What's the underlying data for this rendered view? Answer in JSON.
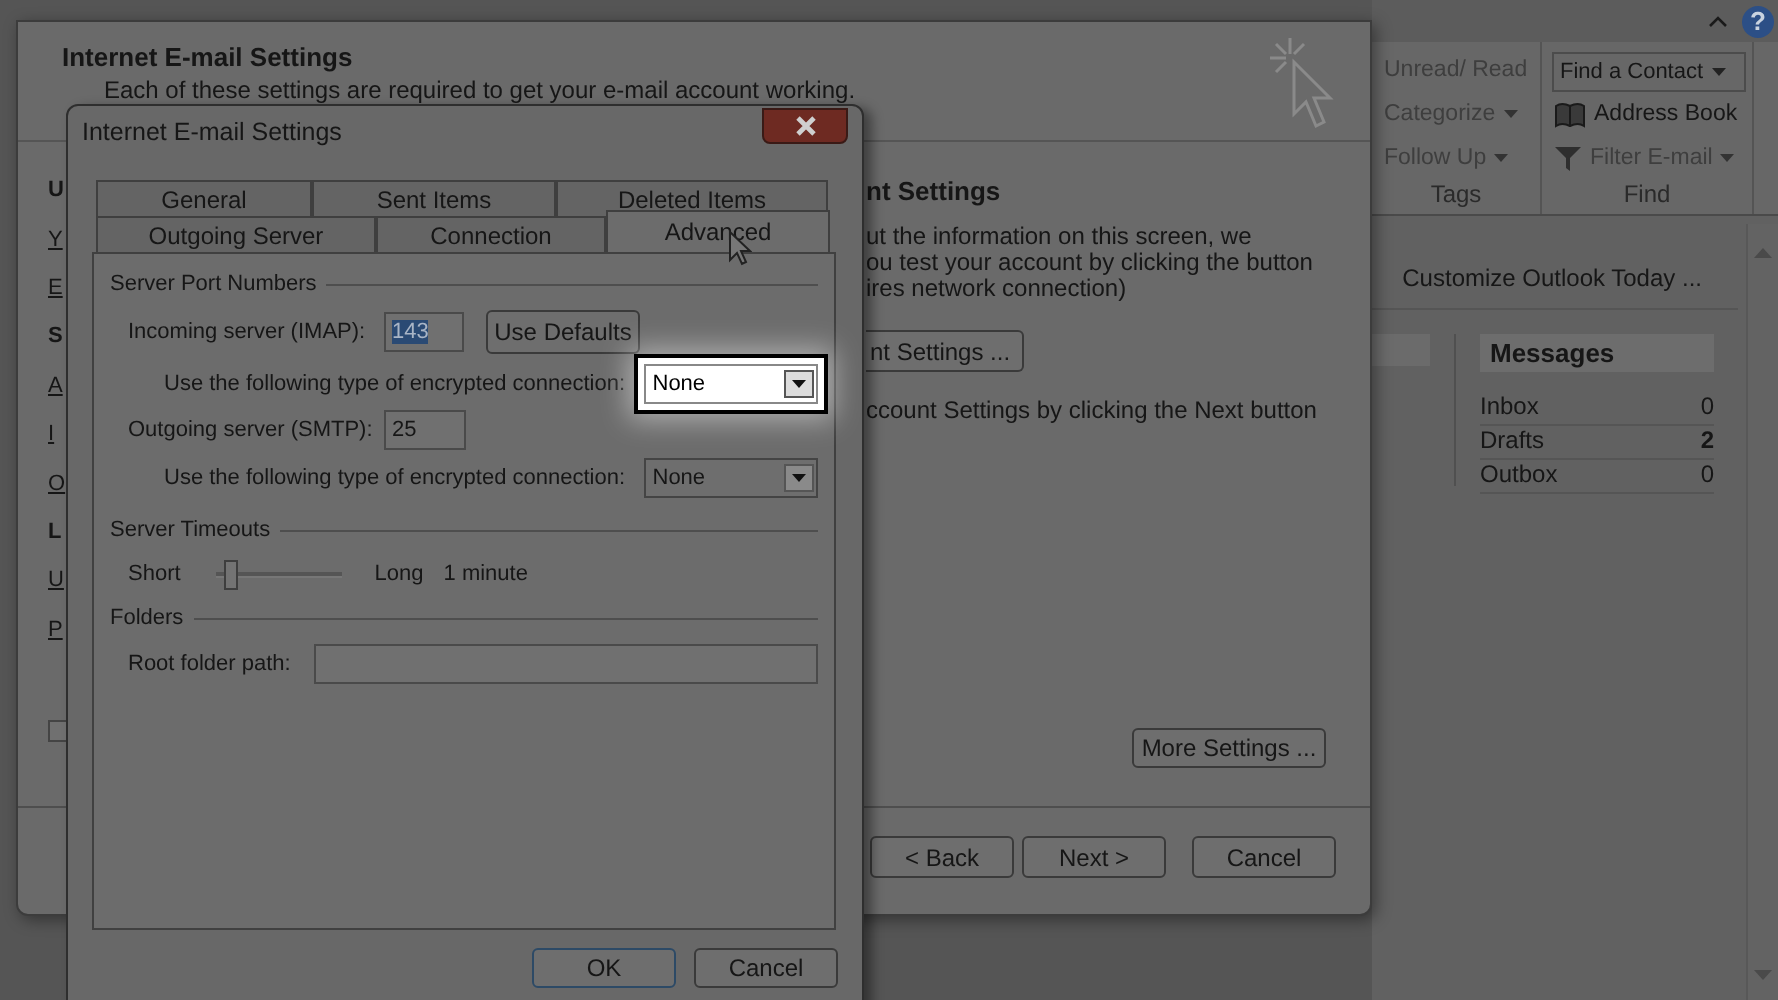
{
  "outlook": {
    "help": "?",
    "tags_group": {
      "label": "Tags",
      "items": [
        {
          "label": "Unread/ Read",
          "dropdown": false
        },
        {
          "label": "Categorize",
          "dropdown": true
        },
        {
          "label": "Follow Up",
          "dropdown": true
        }
      ]
    },
    "find_group": {
      "label": "Find",
      "contact_field": "Find a Contact",
      "items": [
        {
          "label": "Address Book",
          "kind": "book",
          "dropdown": false
        },
        {
          "label": "Filter E-mail",
          "kind": "filter",
          "dropdown": true
        }
      ]
    },
    "customize_link": "Customize Outlook Today ...",
    "messages": {
      "title": "Messages",
      "rows": [
        {
          "name": "Inbox",
          "count": "0",
          "bold": false
        },
        {
          "name": "Drafts",
          "count": "2",
          "bold": true
        },
        {
          "name": "Outbox",
          "count": "0",
          "bold": false
        }
      ]
    }
  },
  "background_dialog": {
    "title": "Internet E-mail Settings",
    "subtitle": "Each of these settings are required to get your e-mail account working.",
    "left_fragments": [
      {
        "text": "U",
        "kind": "heading"
      },
      {
        "text": "Y",
        "kind": "link"
      },
      {
        "text": "E",
        "kind": "link"
      },
      {
        "text": "S",
        "kind": "heading"
      },
      {
        "text": "A",
        "kind": "link"
      },
      {
        "text": "I",
        "kind": "link"
      },
      {
        "text": "O",
        "kind": "link"
      },
      {
        "text": "L",
        "kind": "heading"
      },
      {
        "text": "U",
        "kind": "link"
      },
      {
        "text": "P",
        "kind": "link"
      }
    ],
    "checkbox": {
      "checked": false
    },
    "heading": "nt Settings",
    "text_lines": [
      "ut the information on this screen, we",
      "ou test your account by clicking the button",
      "ires network connection)"
    ],
    "test_button": "nt Settings ...",
    "next_hint": "ccount Settings by clicking the Next button",
    "more_settings_button": "More Settings ...",
    "buttons": [
      "< Back",
      "Next >",
      "Cancel"
    ]
  },
  "dialog": {
    "title": "Internet E-mail Settings",
    "tab_rows": [
      [
        {
          "label": "General",
          "selected": false
        },
        {
          "label": "Sent Items",
          "selected": false
        },
        {
          "label": "Deleted Items",
          "selected": false
        }
      ],
      [
        {
          "label": "Outgoing Server",
          "selected": false
        },
        {
          "label": "Connection",
          "selected": false
        },
        {
          "label": "Advanced",
          "selected": true
        }
      ]
    ],
    "port_group": "Server Port Numbers",
    "incoming": {
      "label": "Incoming server (IMAP):",
      "value": "143",
      "text_selected": true
    },
    "use_defaults_button": "Use Defaults",
    "incoming_encryption": {
      "label": "Use the following type of encrypted connection:",
      "value": "None",
      "highlighted": true
    },
    "outgoing": {
      "label": "Outgoing server (SMTP):",
      "value": "25",
      "text_selected": false
    },
    "outgoing_encryption": {
      "label": "Use the following type of encrypted connection:",
      "value": "None",
      "highlighted": false
    },
    "timeout_group": "Server Timeouts",
    "timeout": {
      "min_label": "Short",
      "max_label": "Long",
      "level": 0.1,
      "reading": "1 minute"
    },
    "folders_group": "Folders",
    "root_folder": {
      "label": "Root folder path:"
    },
    "buttons": [
      "OK",
      "Cancel"
    ]
  }
}
